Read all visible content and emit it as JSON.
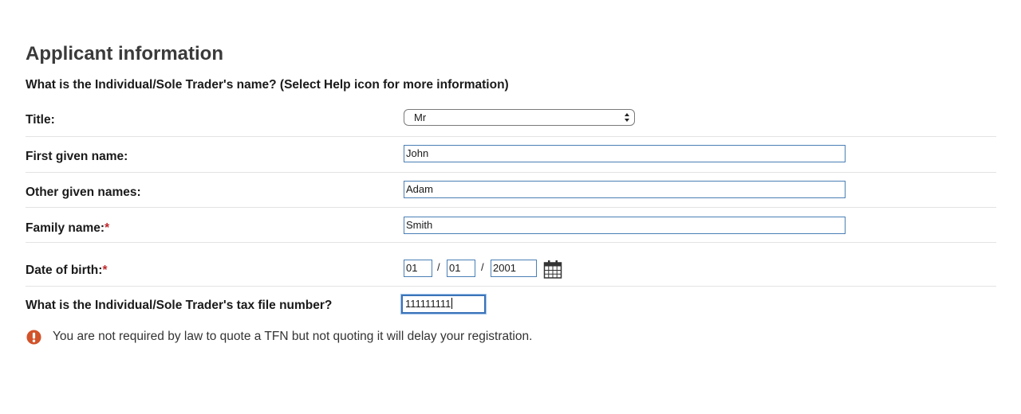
{
  "section": {
    "title": "Applicant information",
    "question": "What is the Individual/Sole Trader's name? (Select Help icon for more information)"
  },
  "fields": {
    "title": {
      "label": "Title:",
      "value": "Mr"
    },
    "first_given_name": {
      "label": "First given name:",
      "value": "John"
    },
    "other_given_names": {
      "label": "Other given names:",
      "value": "Adam"
    },
    "family_name": {
      "label": "Family name:",
      "required_marker": "*",
      "value": "Smith"
    },
    "date_of_birth": {
      "label": "Date of birth:",
      "required_marker": "*",
      "day": "01",
      "month": "01",
      "year": "2001",
      "separator": "/"
    },
    "tfn": {
      "label": "What is the Individual/Sole Trader's tax file number?",
      "value": "111111111"
    }
  },
  "notice": {
    "icon": "exclamation-circle-icon",
    "text": "You are not required by law to quote a TFN but not quoting it will delay your registration."
  },
  "colors": {
    "required": "#c0282d",
    "warning_icon": "#d2522a",
    "input_border": "#4a7fb5",
    "focus_border": "#3b73b9"
  }
}
